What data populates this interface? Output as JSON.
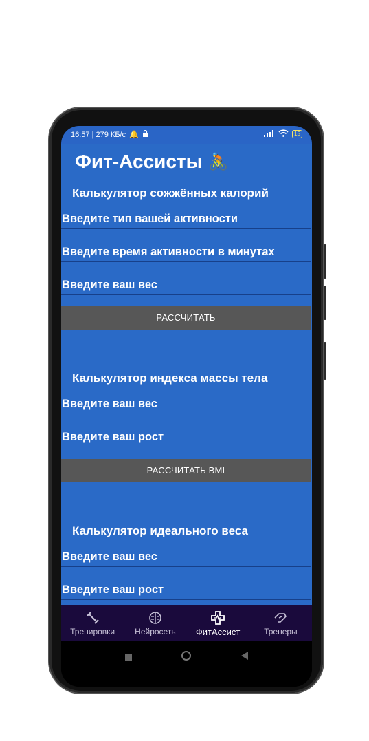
{
  "status": {
    "time_speed": "16:57 | 279 КБ/с",
    "battery": "15"
  },
  "app": {
    "title": "Фит-Ассисты",
    "title_emoji": "🚴"
  },
  "calories": {
    "title": "Калькулятор сожжённых калорий",
    "activity_type": "Введите тип вашей активности",
    "activity_time": "Введите время активности в минутах",
    "weight": "Введите ваш вес",
    "button": "РАССЧИТАТЬ"
  },
  "bmi": {
    "title": "Калькулятор индекса массы тела",
    "weight": "Введите ваш вес",
    "height": "Введите ваш рост",
    "button": "РАССЧИТАТЬ BMI"
  },
  "ideal": {
    "title": "Калькулятор идеального веса",
    "weight": "Введите ваш вес",
    "height": "Введите ваш рост"
  },
  "nav": {
    "items": [
      {
        "label": "Тренировки",
        "icon": "dumbbell-icon"
      },
      {
        "label": "Нейросеть",
        "icon": "brain-icon"
      },
      {
        "label": "ФитАссист",
        "icon": "medical-cross-icon"
      },
      {
        "label": "Тренеры",
        "icon": "handshake-icon"
      }
    ],
    "active": "ФитАссист"
  },
  "colors": {
    "app_bg": "#2a6ac7",
    "button_bg": "#575757",
    "nav_bg": "#1a0a3c"
  }
}
